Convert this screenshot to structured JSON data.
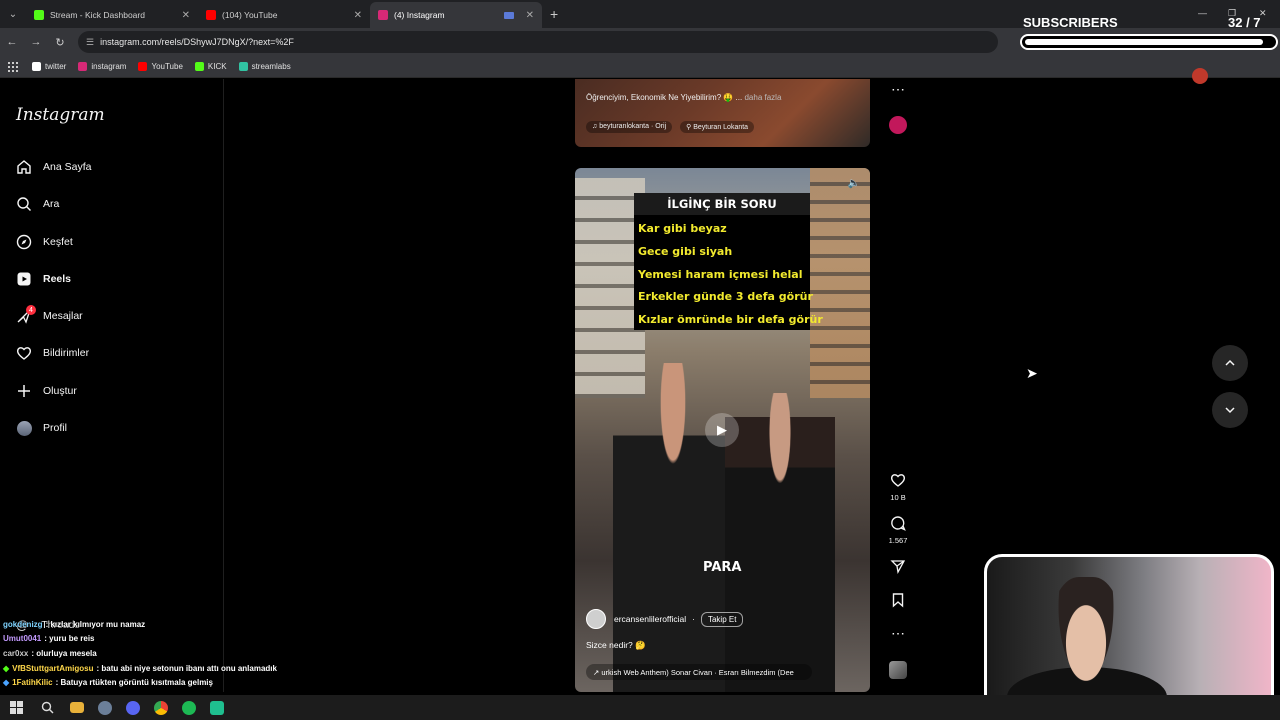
{
  "browser": {
    "tabs": [
      {
        "title": "Stream - Kick Dashboard",
        "color": "#53fc18"
      },
      {
        "title": "(104) YouTube",
        "color": "#ff0000"
      },
      {
        "title": "(4) Instagram",
        "color": "#d62976"
      }
    ],
    "url": "instagram.com/reels/DShywJ7DNgX/?next=%2F",
    "bookmarks": [
      {
        "label": "twitter",
        "color": "#ffffff"
      },
      {
        "label": "instagram",
        "color": "#d62976"
      },
      {
        "label": "YouTube",
        "color": "#ff0000"
      },
      {
        "label": "KICK",
        "color": "#53fc18"
      },
      {
        "label": "streamlabs",
        "color": "#31c3a2"
      }
    ]
  },
  "instagram": {
    "logo": "Instagram",
    "nav": [
      {
        "label": "Ana Sayfa",
        "icon": "home-icon"
      },
      {
        "label": "Ara",
        "icon": "search-icon"
      },
      {
        "label": "Keşfet",
        "icon": "compass-icon"
      },
      {
        "label": "Reels",
        "icon": "reels-icon"
      },
      {
        "label": "Mesajlar",
        "icon": "messenger-icon",
        "badge": "4"
      },
      {
        "label": "Bildirimler",
        "icon": "heart-icon"
      },
      {
        "label": "Oluştur",
        "icon": "plus-icon"
      },
      {
        "label": "Profil",
        "icon": "avatar"
      }
    ],
    "threads": "Threads",
    "prev_reel": {
      "caption": "Öğrenciyim, Ekonomik Ne Yiyebilirim? 🤑 ...",
      "more": "daha fazla",
      "audio": "beyturanlokanta · Orij",
      "location": "Beyturan Lokanta"
    },
    "reel": {
      "overlay_title": "İLGİNÇ BİR SORU",
      "overlay_lines": [
        "Kar gibi beyaz",
        "Gece gibi siyah",
        "Yemesi haram içmesi helal",
        "Erkekler günde 3 defa görür",
        "Kızlar ömründe bir defa görür"
      ],
      "subtitle": "PARA",
      "author": "ercansenlilerofficial",
      "follow": "Takip Et",
      "description": "Sizce nedir? 🤔",
      "audio": "urkish Web Anthem)  Sonar Civan · Esrarı Bilmezdim (Dee",
      "likes": "10 B",
      "comments": "1.567"
    }
  },
  "stream": {
    "subs_label": "SUBSCRIBERS",
    "subs_count": "32 / 7",
    "subs_progress": 0.96
  },
  "chat": [
    {
      "user": "gokdenizg",
      "msg": ": kızlar kılmıyor mu namaz",
      "color": "#7fd3ff"
    },
    {
      "user": "Umut0041",
      "msg": ": yuru be reis",
      "color": "#c49bff"
    },
    {
      "user": "car0xx",
      "msg": ": olurluya mesela",
      "color": "#c9c9c9"
    },
    {
      "user": "VfBStuttgartAmigosu",
      "msg": ": batu abi niye setonun ibanı attı onu anlamadık",
      "color": "#ffd84a"
    },
    {
      "user": "1FatihKilic",
      "msg": ": Batuya rtükten görüntü kısıtmala gelmiş",
      "color": "#ffd84a"
    }
  ]
}
